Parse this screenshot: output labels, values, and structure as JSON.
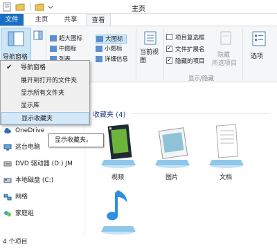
{
  "window": {
    "title": "主页"
  },
  "tabs": {
    "file": "文件",
    "home": "主页",
    "share": "共享",
    "view": "查看"
  },
  "ribbon": {
    "nav_pane": "导航窗格",
    "layout": {
      "extra_large_icons": "超大图标",
      "large_icons": "大图标",
      "medium_icons": "中图标",
      "small_icons": "小图标",
      "list": "列表",
      "details": "详细信息"
    },
    "current_view": "当前视图",
    "show_hide": {
      "item_checkboxes": "项目复选框",
      "file_extensions": "文件扩展名",
      "hidden_items": "隐藏的项目",
      "group_label": "显示/隐藏"
    },
    "hide_selected": "隐藏所选项目",
    "hide_label": "隐藏",
    "selected_label": "所选项目",
    "options": "选项"
  },
  "menu": {
    "items": [
      "导航窗格",
      "展开到打开的文件夹",
      "显示所有文件夹",
      "显示库",
      "显示收藏夹"
    ],
    "checked_index": 0,
    "hovered_index": 4
  },
  "tooltip": "显示收藏夹。",
  "nav": {
    "items": [
      "OneDrive",
      "这台电脑",
      "DVD 驱动器 (D:) JM",
      "本地磁盘 (C:)",
      "网络",
      "家庭组"
    ]
  },
  "main": {
    "group_header": "收藏夹 (4)",
    "libraries": [
      "视频",
      "图片",
      "文档",
      "音乐"
    ]
  },
  "status": {
    "item_count": "4 个项目"
  },
  "colors": {
    "accent": "#1a6fc4",
    "hover": "#d5e8f8",
    "group_header": "#1e3f8a"
  }
}
